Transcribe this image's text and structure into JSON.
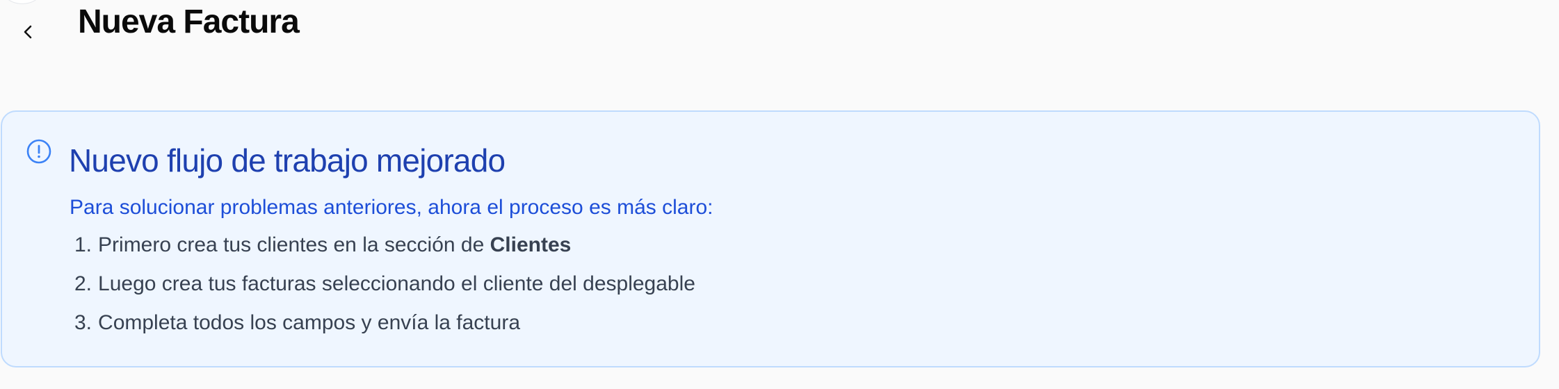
{
  "header": {
    "title": "Nueva Factura",
    "back_icon": "chevron-left-icon"
  },
  "notice": {
    "icon": "info-circle-icon",
    "title": "Nuevo flujo de trabajo mejorado",
    "intro": "Para solucionar problemas anteriores, ahora el proceso es más claro:",
    "steps": [
      {
        "number": "1.",
        "text": "Primero crea tus clientes en la sección de ",
        "emphasis": "Clientes"
      },
      {
        "number": "2.",
        "text": "Luego crea tus facturas seleccionando el cliente del desplegable"
      },
      {
        "number": "3.",
        "text": "Completa todos los campos y envía la factura"
      }
    ]
  },
  "colors": {
    "background": "#fafafa",
    "card_background": "#eff6ff",
    "card_border": "#bfdbfe",
    "title_blue": "#1e40af",
    "intro_blue": "#1d4ed8",
    "body_text": "#374151"
  }
}
